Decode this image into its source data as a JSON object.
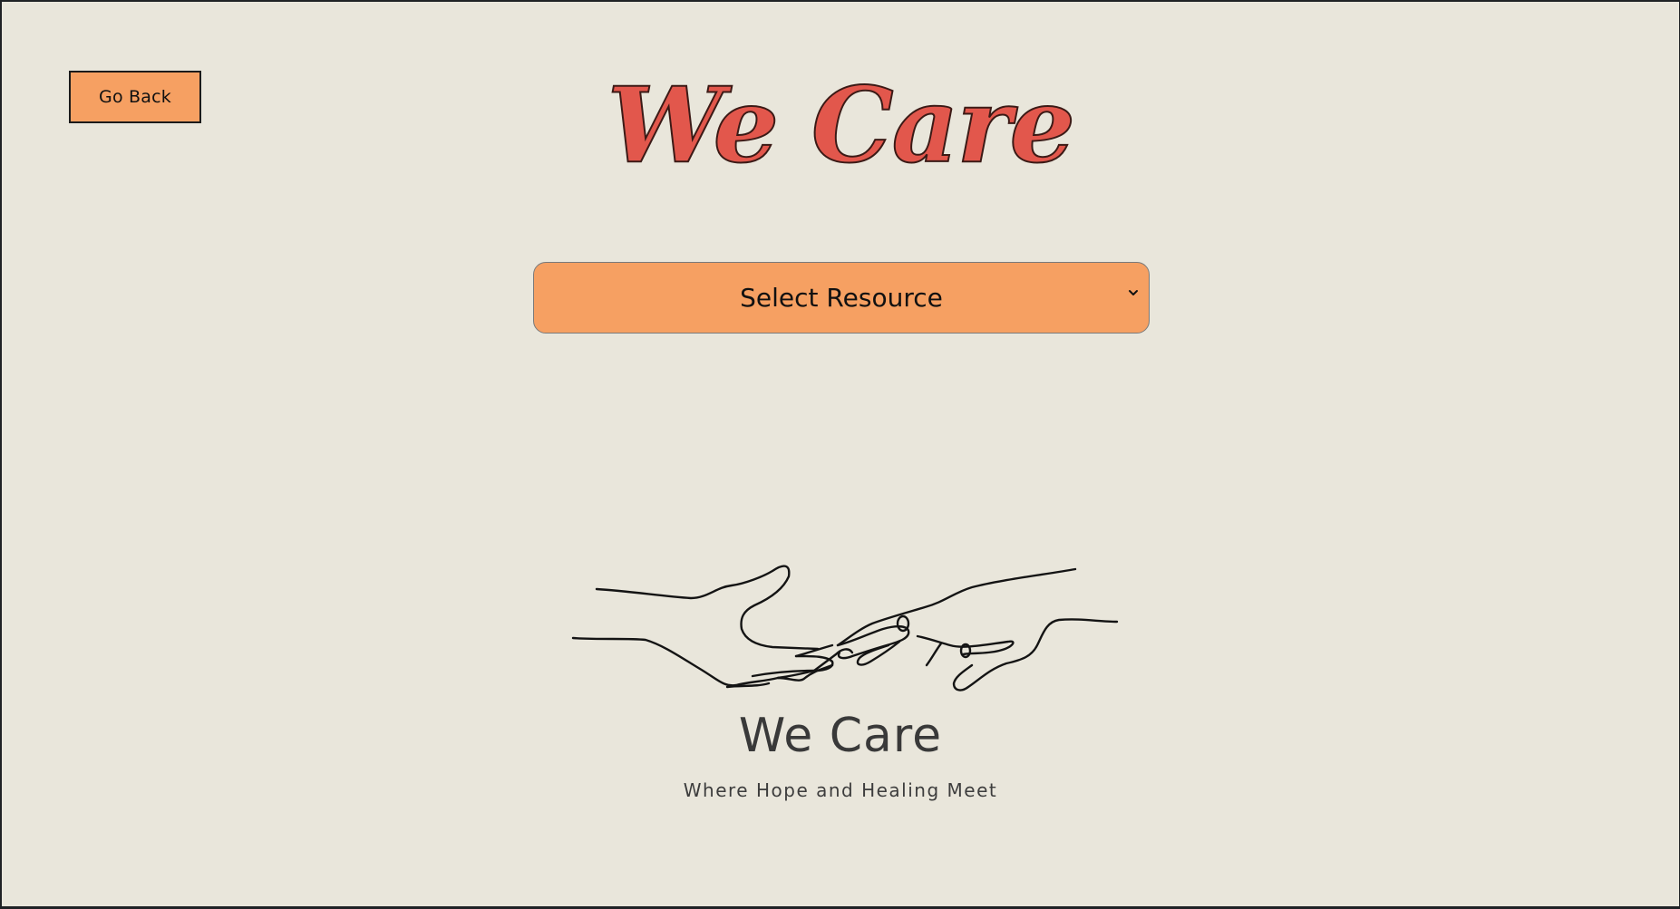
{
  "header": {
    "back_button_label": "Go Back",
    "title": "We Care"
  },
  "resource_select": {
    "selected_label": "Select Resource",
    "chevron_icon": "chevron-down-icon"
  },
  "logo": {
    "icon": "hands-reaching-icon",
    "name": "We Care",
    "tagline": "Where Hope and Healing Meet"
  },
  "colors": {
    "background": "#e9e6db",
    "accent": "#f6a062",
    "title": "#e2574c",
    "frame": "#1f2225"
  }
}
